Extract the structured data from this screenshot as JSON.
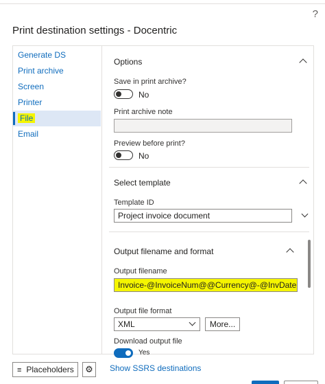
{
  "dialog": {
    "title": "Print destination settings - Docentric",
    "help_label": "?"
  },
  "nav": {
    "items": [
      {
        "label": "Generate DS"
      },
      {
        "label": "Print archive"
      },
      {
        "label": "Screen"
      },
      {
        "label": "Printer"
      },
      {
        "label": "File",
        "selected": true
      },
      {
        "label": "Email"
      }
    ]
  },
  "options": {
    "title": "Options",
    "save_archive_label": "Save in print archive?",
    "save_archive_value": "No",
    "archive_note_label": "Print archive note",
    "archive_note_value": "",
    "preview_label": "Preview before print?",
    "preview_value": "No"
  },
  "template": {
    "title": "Select template",
    "template_id_label": "Template ID",
    "template_id_value": "Project invoice document"
  },
  "output": {
    "title": "Output filename and format",
    "filename_label": "Output filename",
    "filename_value": "Invoice-@InvoiceNum@@Currency@-@InvDate...",
    "format_label": "Output file format",
    "format_value": "XML",
    "more_button": "More...",
    "download_label": "Download output file",
    "download_value": "Yes"
  },
  "footer": {
    "placeholders_button": "Placeholders",
    "ssrs_link": "Show SSRS destinations"
  },
  "colors": {
    "accent": "#0f6cbd",
    "highlight": "#f5f500",
    "border": "#e1dfdd"
  }
}
